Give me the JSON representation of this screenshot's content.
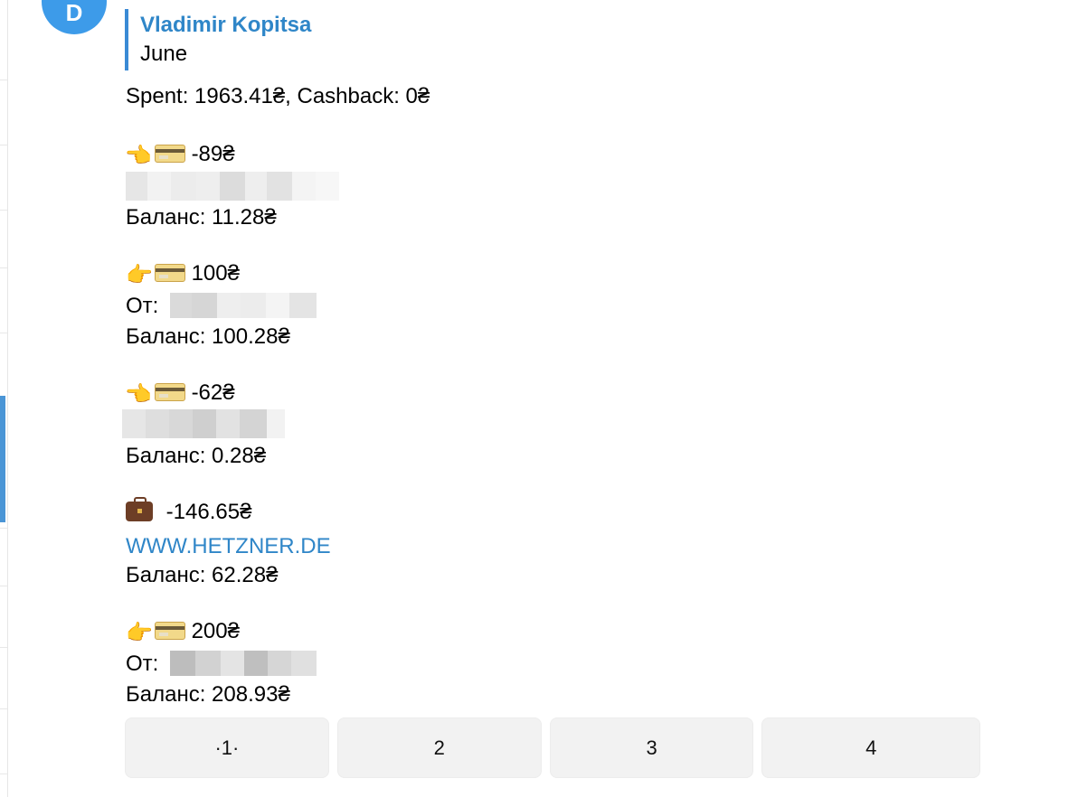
{
  "avatar": {
    "letter": "D"
  },
  "forwarded": {
    "name": "Vladimir Kopitsa",
    "subtitle": "June"
  },
  "summary": "Spent: 1963.41₴, Cashback: 0₴",
  "transactions": [
    {
      "icon": "hand-left-card-icon",
      "amount": "-89₴",
      "balance": "Баланс: 11.28₴"
    },
    {
      "icon": "hand-right-card-icon",
      "amount": "100₴",
      "from_label": "От:",
      "balance": "Баланс: 100.28₴"
    },
    {
      "icon": "hand-left-card-icon",
      "amount": "-62₴",
      "balance": "Баланс: 0.28₴"
    },
    {
      "icon": "briefcase-icon",
      "amount": "-146.65₴",
      "link": "WWW.HETZNER.DE",
      "balance": "Баланс: 62.28₴"
    },
    {
      "icon": "hand-right-card-icon",
      "amount": "200₴",
      "from_label": "От:",
      "balance": "Баланс: 208.93₴"
    }
  ],
  "pagination": [
    "·1·",
    "2",
    "3",
    "4"
  ],
  "colors": {
    "accent": "#2f86c8",
    "avatar": "#3d9be9",
    "button_bg": "#f2f2f2"
  }
}
